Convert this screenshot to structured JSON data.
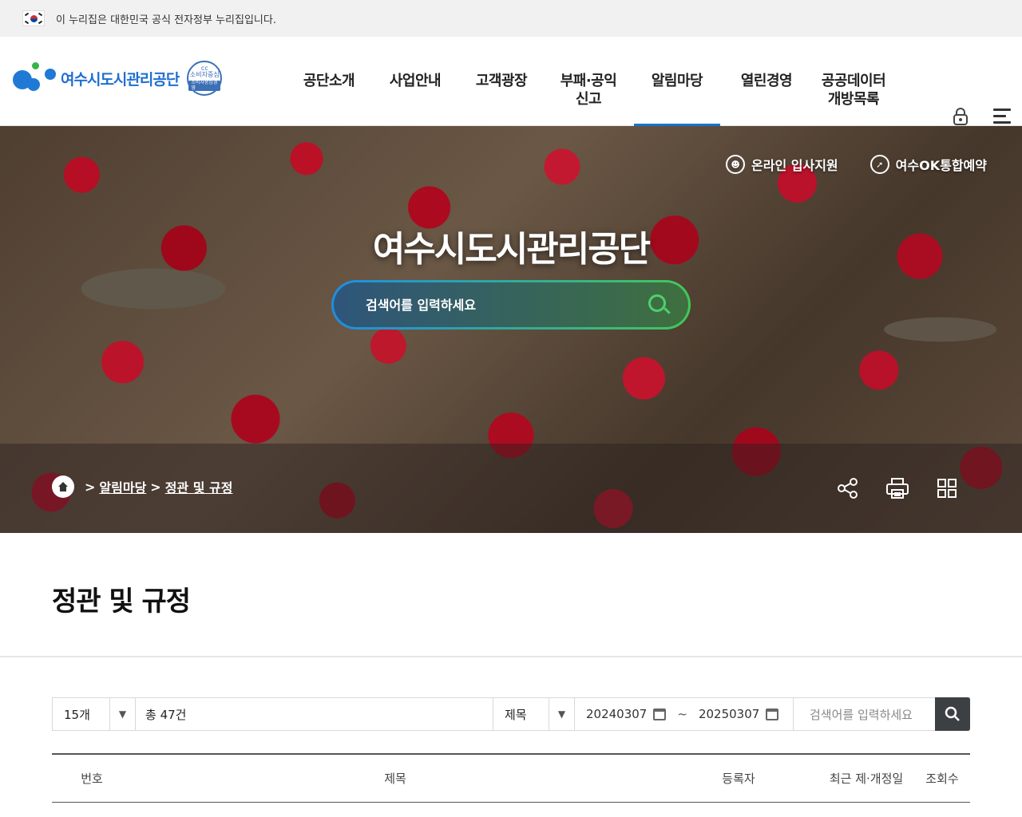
{
  "gov_banner": {
    "text": "이 누리집은 대한민국 공식 전자정부 누리집입니다."
  },
  "logo": {
    "name": "여수시도시관리공단",
    "badge_top": "cc",
    "badge_main": "소비자중심",
    "badge_sub": "소비자중심경영"
  },
  "gnb": [
    {
      "label": "공단소개"
    },
    {
      "label": "사업안내"
    },
    {
      "label": "고객광장"
    },
    {
      "label": "부패·공익\n신고"
    },
    {
      "label": "알림마당"
    },
    {
      "label": "열린경영"
    },
    {
      "label": "공공데이터\n개방목록"
    }
  ],
  "hero": {
    "title": "여수시도시관리공단",
    "search_placeholder": "검색어를 입력하세요",
    "quick_links": [
      {
        "label": "온라인 입사지원",
        "icon": "person-icon"
      },
      {
        "label": "여수OK통합예약",
        "icon": "arrow-icon"
      }
    ]
  },
  "breadcrumb": {
    "sep1": ">",
    "item1": "알림마당",
    "sep2": ">",
    "item2": "정관 및 규정"
  },
  "page": {
    "title": "정관 및 규정"
  },
  "filter": {
    "page_size": "15개",
    "total": "총 47건",
    "field": "제목",
    "date_from": "20240307",
    "tilde": "~",
    "date_to": "20250307",
    "keyword_placeholder": "검색어를 입력하세요"
  },
  "table": {
    "headers": [
      "번호",
      "제목",
      "등록자",
      "최근 제·개정일",
      "조회수"
    ]
  },
  "colors": {
    "accent": "#1a73c9",
    "logo": "#1f6fd0",
    "search_green": "#4ed06a"
  }
}
